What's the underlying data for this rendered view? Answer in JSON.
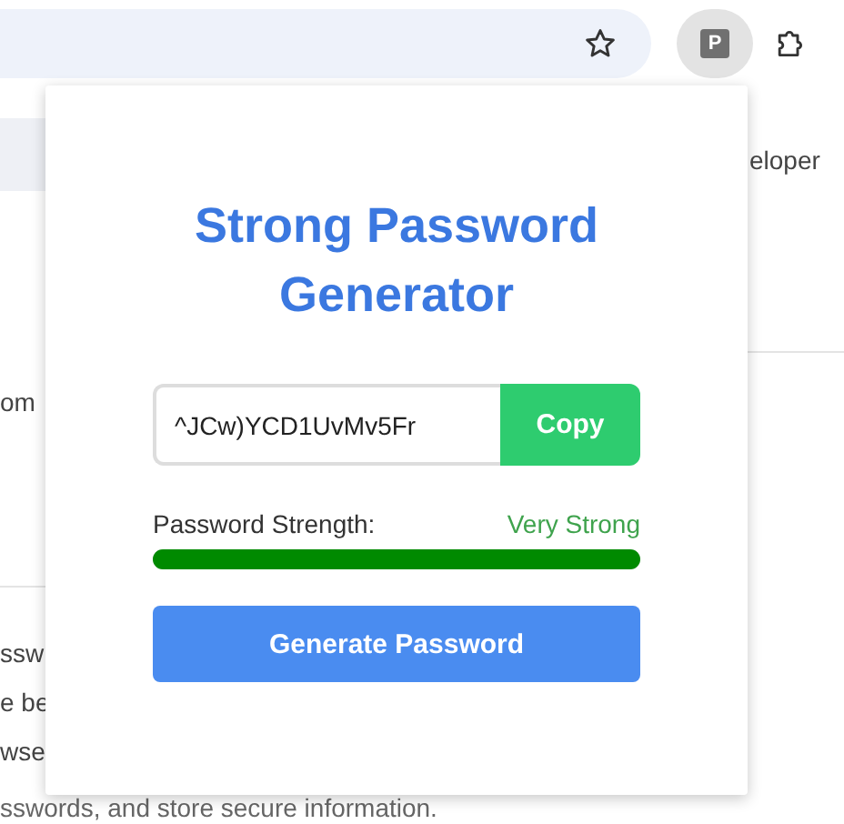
{
  "background_page": {
    "texts": [
      "eloper",
      "om",
      "ssw",
      "e be",
      "wse",
      "sswords, and store secure information."
    ]
  },
  "extension_badge": "P",
  "popup": {
    "title": "Strong Password Generator",
    "password": {
      "value": "^JCw)YCD1UvMv5Fr"
    },
    "copy_button": "Copy",
    "strength": {
      "label": "Password Strength:",
      "reading": "Very Strong",
      "level": 1.0
    },
    "generate_button": "Generate Password"
  }
}
